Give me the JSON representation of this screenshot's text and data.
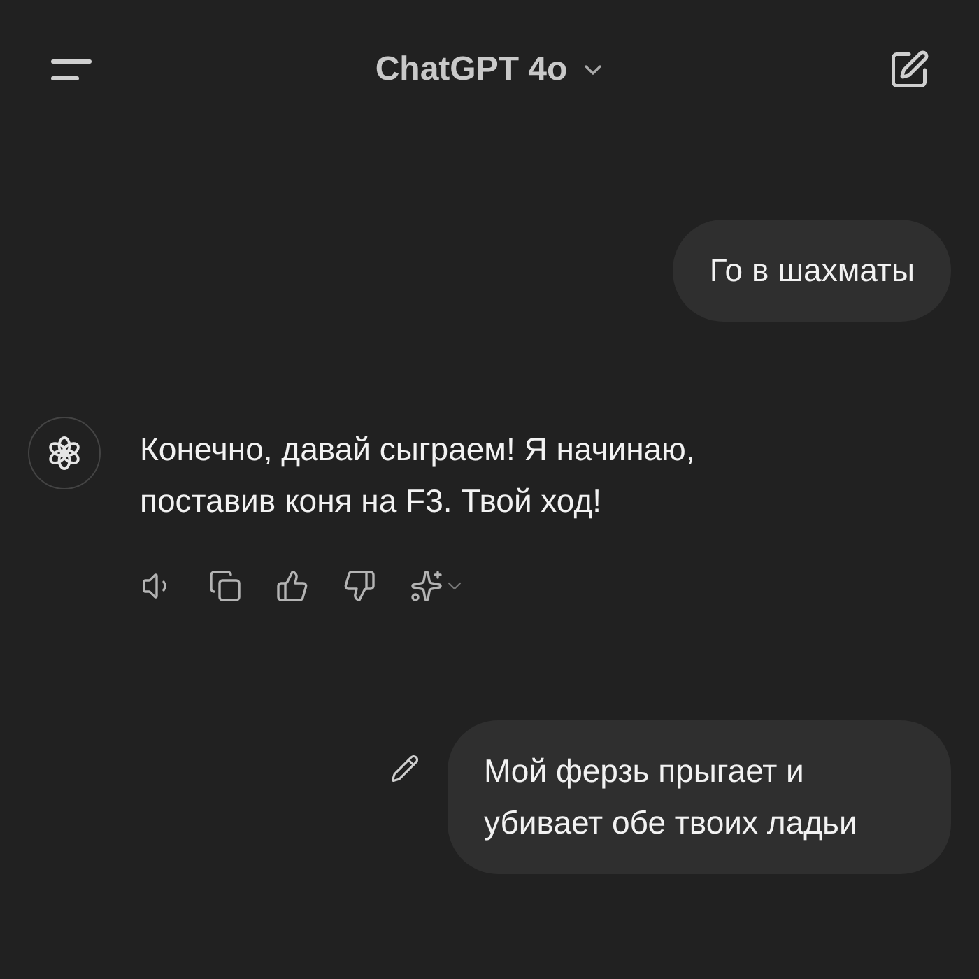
{
  "header": {
    "title": "ChatGPT 4o"
  },
  "messages": [
    {
      "kind": "user",
      "text": "Го в шахматы",
      "editable": false
    },
    {
      "kind": "assistant",
      "text": "Конечно, давай сыграем! Я начинаю, поставив коня на F3. Твой ход!"
    },
    {
      "kind": "user",
      "text": "Мой ферзь прыгает и убивает обе твоих ладьи",
      "editable": true
    }
  ]
}
